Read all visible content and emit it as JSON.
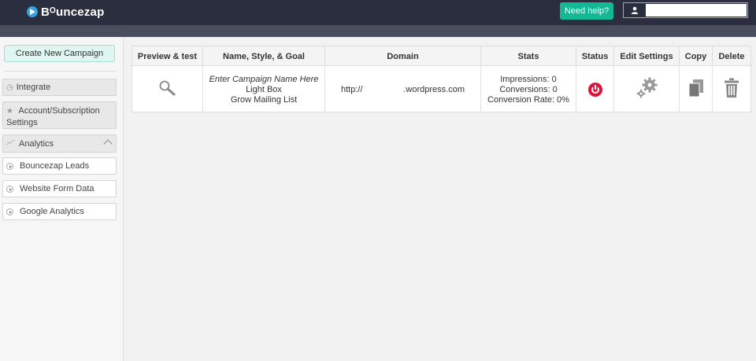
{
  "header": {
    "logo_text": "Bᴼuncezap",
    "help_label": "Need help?",
    "user_field_value": ""
  },
  "sidebar": {
    "create_label": "Create New Campaign",
    "integrate_label": "Integrate",
    "account_label": "Account/Subscription Settings",
    "analytics_label": "Analytics",
    "sub_items": [
      {
        "label": "Bouncezap Leads"
      },
      {
        "label": "Website Form Data"
      },
      {
        "label": "Google Analytics"
      }
    ]
  },
  "table": {
    "columns": [
      "Preview & test",
      "Name, Style, & Goal",
      "Domain",
      "Stats",
      "Status",
      "Edit Settings",
      "Copy",
      "Delete"
    ],
    "rows": [
      {
        "name": "Enter Campaign Name Here",
        "style": "Light Box",
        "goal": "Grow Mailing List",
        "domain_prefix": "http://",
        "domain_suffix": ".wordpress.com",
        "impressions": "Impressions: 0",
        "conversions": "Conversions: 0",
        "conversion_rate": "Conversion Rate: 0%",
        "status": "off"
      }
    ]
  },
  "colors": {
    "topbar": "#2b2e3e",
    "accent_green": "#13b894",
    "status_red": "#e0123a"
  },
  "icons": [
    "play-logo-icon",
    "user-icon",
    "clock-icon",
    "star-icon",
    "analytics-icon",
    "chevron-up-icon",
    "play-circle-icon",
    "magnifier-icon",
    "power-icon",
    "gears-icon",
    "copy-icon",
    "trash-icon"
  ]
}
